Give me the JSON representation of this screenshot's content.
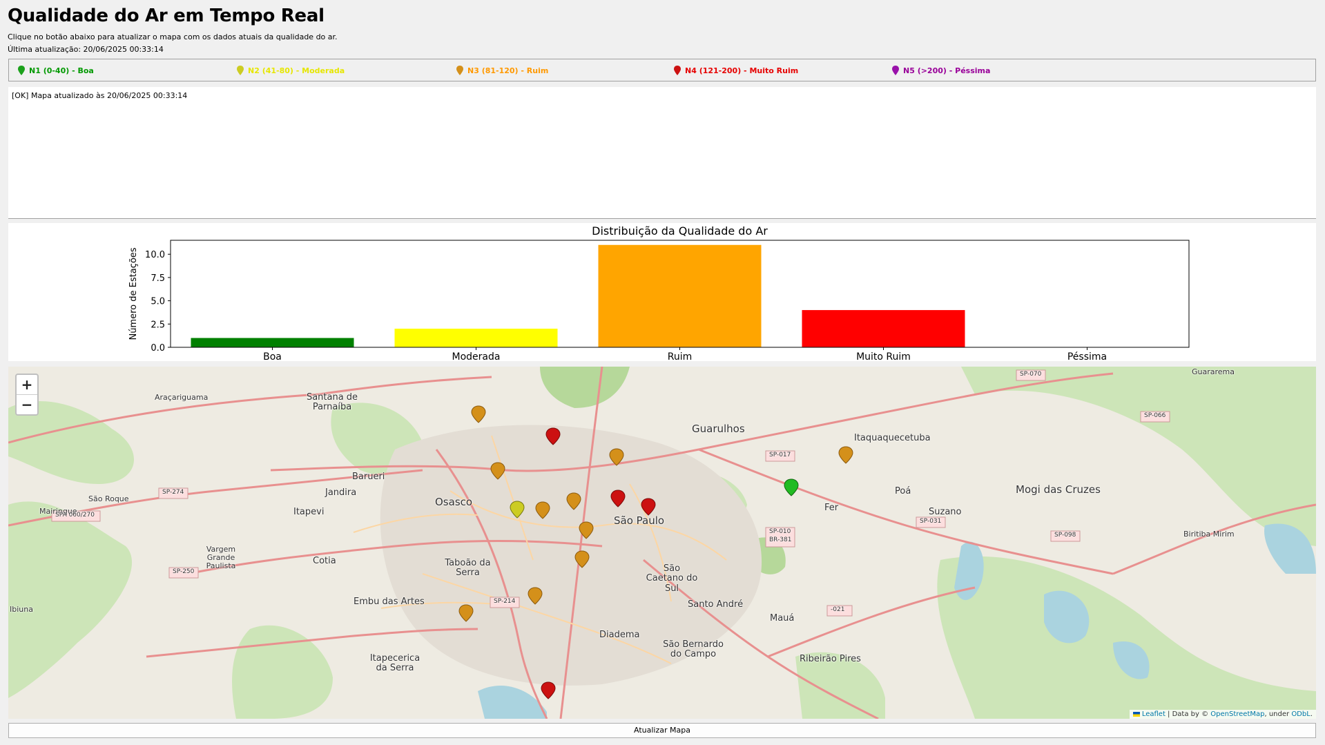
{
  "header": {
    "title": "Qualidade do Ar em Tempo Real",
    "subtitle": "Clique no botão abaixo para atualizar o mapa com os dados atuais da qualidade do ar.",
    "last_update": "Última atualização: 20/06/2025 00:33:14"
  },
  "legend": [
    {
      "label": "N1 (0-40) - Boa",
      "color": "#009900"
    },
    {
      "label": "N2 (41-80) - Moderada",
      "color": "#e6e600"
    },
    {
      "label": "N3 (81-120) - Ruim",
      "color": "#ff9900"
    },
    {
      "label": "N4 (121-200) - Muito Ruim",
      "color": "#e60000"
    },
    {
      "label": "N5 (>200) - Péssima",
      "color": "#990099"
    }
  ],
  "log": {
    "text": "[OK] Mapa atualizado às 20/06/2025 00:33:14"
  },
  "chart_data": {
    "type": "bar",
    "title": "Distribuição da Qualidade do Ar",
    "xlabel": "",
    "ylabel": "Número de Estações",
    "categories": [
      "Boa",
      "Moderada",
      "Ruim",
      "Muito Ruim",
      "Péssima"
    ],
    "values": [
      1,
      2,
      11,
      4,
      0
    ],
    "colors": [
      "#008000",
      "#ffff00",
      "#ffa500",
      "#ff0000",
      "#800080"
    ],
    "ylim": [
      0,
      11.5
    ],
    "yticks": [
      "0.0",
      "2.5",
      "5.0",
      "7.5",
      "10.0"
    ],
    "grid": false,
    "legend": "none"
  },
  "map": {
    "zoom_in": "+",
    "zoom_out": "−",
    "attribution_prefix": "Leaflet",
    "attribution_mid": " | Data by © ",
    "attribution_osm": "OpenStreetMap",
    "attribution_under": ", under ",
    "attribution_odbl": "ODbL",
    "attribution_end": ".",
    "labels": {
      "sao_paulo": "São Paulo",
      "guarulhos": "Guarulhos",
      "osasco": "Osasco",
      "barueri": "Barueri",
      "jandira": "Jandira",
      "itapevi": "Itapevi",
      "cotia": "Cotia",
      "taboao": "Taboão da Serra",
      "embu": "Embu das Artes",
      "itapecerica": "Itapecerica da Serra",
      "diadema": "Diadema",
      "sbc": "São Bernardo do Campo",
      "santo_andre": "Santo André",
      "sao_caetano": "São Caetano do Sul",
      "maua": "Mauá",
      "ribeirao_pires": "Ribeirão Pires",
      "suzano": "Suzano",
      "poa": "Poá",
      "fer": "Fer",
      "itaquaquecetuba": "Itaquaquecetuba",
      "mogi": "Mogi das Cruzes",
      "santana": "Santana de Parnaíba",
      "aracariguama": "Araçariguama",
      "sao_roque": "São Roque",
      "mairinque": "Mairinque",
      "vargem": "Vargem Grande Paulista",
      "ibiuna": "Ibiuna",
      "biritiba": "Biritiba Mirim",
      "guararema": "Guararema",
      "sp274": "SP-274",
      "spa060": "SPA 060/270",
      "sp250": "SP-250",
      "sp214": "SP-214",
      "sp017": "SP-017",
      "sp010": "SP-010",
      "br381": "BR-381",
      "sp031": "SP-031",
      "sp066": "SP-066",
      "sp070": "SP-070",
      "sp098": "SP-098",
      "sp021": "-021"
    }
  },
  "button": {
    "label": "Atualizar Mapa"
  }
}
